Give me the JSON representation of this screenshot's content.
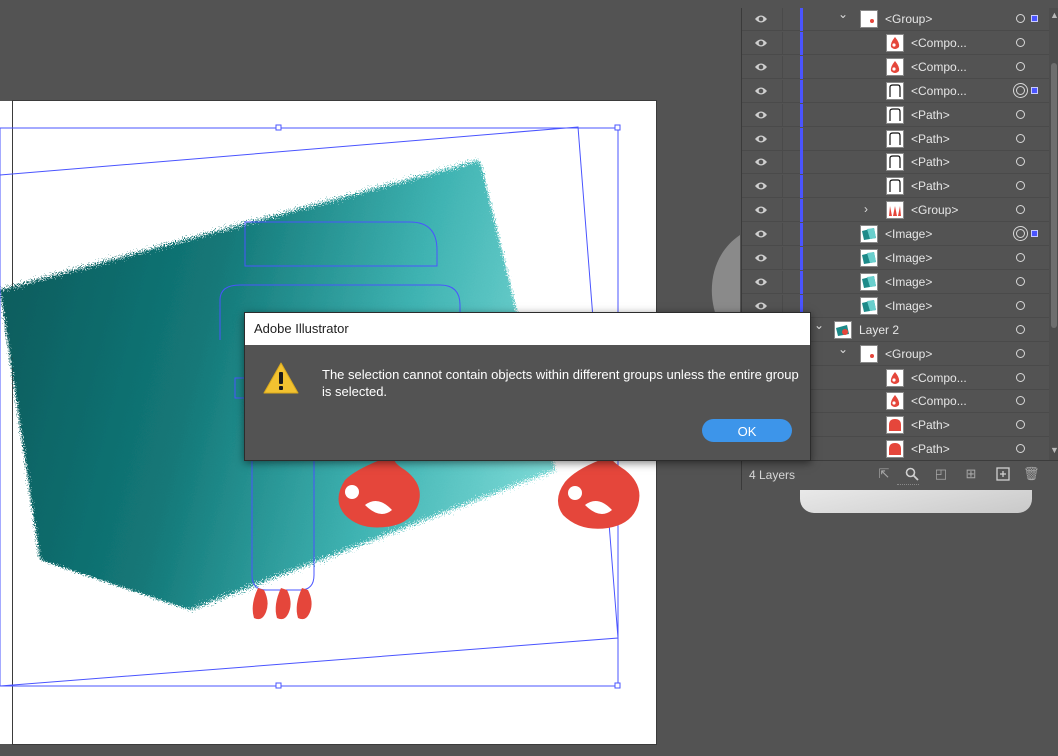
{
  "app": {
    "name": "Adobe Illustrator"
  },
  "colors": {
    "selection": "#4a54ff",
    "flame": "#e5463b",
    "teal_dark": "#0d6e6e",
    "teal_light": "#68d3d1",
    "ok_button": "#3d95ea",
    "warning": "#f2c230"
  },
  "dialog": {
    "title": "Adobe Illustrator",
    "message": "The selection cannot contain objects within different groups unless the entire group is selected.",
    "icon": "warning-icon",
    "ok_label": "OK"
  },
  "layers_panel": {
    "rows": [
      {
        "name": "<Group>",
        "thumb": "group-flame-icon",
        "expanded": true,
        "target": "single",
        "selected": true
      },
      {
        "name": "<Compo...",
        "thumb": "flame-icon",
        "target": "single",
        "selected": false
      },
      {
        "name": "<Compo...",
        "thumb": "flame-icon",
        "target": "single",
        "selected": false
      },
      {
        "name": "<Compo...",
        "thumb": "path-outline-icon",
        "target": "double",
        "selected": true
      },
      {
        "name": "<Path>",
        "thumb": "path-outline-icon",
        "target": "single",
        "selected": false
      },
      {
        "name": "<Path>",
        "thumb": "path-outline-icon",
        "target": "single",
        "selected": false
      },
      {
        "name": "<Path>",
        "thumb": "path-outline-icon",
        "target": "single",
        "selected": false
      },
      {
        "name": "<Path>",
        "thumb": "path-outline-icon",
        "target": "single",
        "selected": false
      },
      {
        "name": "<Group>",
        "thumb": "flames-group-icon",
        "expanded": false,
        "target": "single",
        "selected": false
      },
      {
        "name": "<Image>",
        "thumb": "teal-image-icon",
        "target": "double",
        "selected": true
      },
      {
        "name": "<Image>",
        "thumb": "teal-image-icon",
        "target": "single",
        "selected": false
      },
      {
        "name": "<Image>",
        "thumb": "teal-image-icon",
        "target": "single",
        "selected": false
      },
      {
        "name": "<Image>",
        "thumb": "teal-image-icon",
        "target": "single",
        "selected": false
      },
      {
        "name": "Layer 2",
        "thumb": "layer-thumb-icon",
        "expanded": true,
        "target": "single",
        "selected": false
      },
      {
        "name": "<Group>",
        "thumb": "group-flame-icon",
        "expanded": true,
        "target": "single",
        "selected": false
      },
      {
        "name": "<Compo...",
        "thumb": "flame-icon",
        "target": "single",
        "selected": false
      },
      {
        "name": "<Compo...",
        "thumb": "flame-icon",
        "target": "single",
        "selected": false
      },
      {
        "name": "<Path>",
        "thumb": "red-blob-icon",
        "target": "single",
        "selected": false
      },
      {
        "name": "<Path>",
        "thumb": "red-blob-icon",
        "target": "single",
        "selected": false
      }
    ],
    "footer": {
      "layer_count": "4 Layers",
      "icons": [
        "export-icon",
        "search-icon",
        "make-clipping-mask-icon",
        "new-sublayer-icon",
        "new-layer-icon",
        "delete-icon"
      ]
    }
  }
}
